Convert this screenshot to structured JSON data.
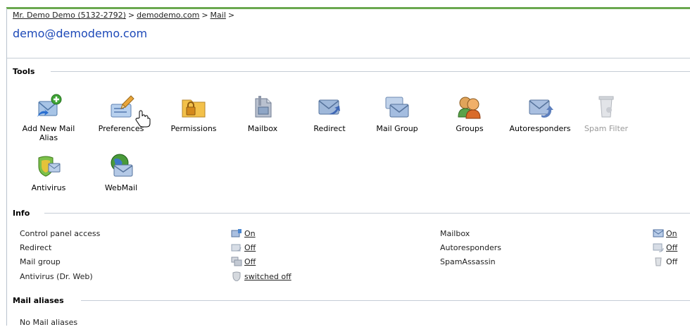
{
  "breadcrumb": {
    "items": [
      "Mr. Demo Demo (5132-2792)",
      "demodemo.com",
      "Mail"
    ],
    "separator": ">"
  },
  "page_title": "demo@demodemo.com",
  "tools": {
    "heading": "Tools",
    "items": [
      {
        "label": "Add New Mail Alias",
        "icon": "add-mail-alias-icon"
      },
      {
        "label": "Preferences",
        "icon": "preferences-icon"
      },
      {
        "label": "Permissions",
        "icon": "permissions-folder-icon"
      },
      {
        "label": "Mailbox",
        "icon": "mailbox-icon"
      },
      {
        "label": "Redirect",
        "icon": "redirect-icon"
      },
      {
        "label": "Mail Group",
        "icon": "mail-group-icon"
      },
      {
        "label": "Groups",
        "icon": "groups-icon"
      },
      {
        "label": "Autoresponders",
        "icon": "autoresponders-icon"
      },
      {
        "label": "Spam Filter",
        "icon": "spam-filter-icon",
        "disabled": true
      },
      {
        "label": "Antivirus",
        "icon": "antivirus-icon"
      },
      {
        "label": "WebMail",
        "icon": "webmail-icon"
      }
    ]
  },
  "info": {
    "heading": "Info",
    "left": [
      {
        "label": "Control panel access",
        "value": "On",
        "link": true
      },
      {
        "label": "Redirect",
        "value": "Off",
        "link": true
      },
      {
        "label": "Mail group",
        "value": "Off",
        "link": true
      },
      {
        "label": "Antivirus (Dr. Web)",
        "value": "switched off",
        "link": true
      }
    ],
    "right": [
      {
        "label": "Mailbox",
        "value": "On",
        "link": true
      },
      {
        "label": "Autoresponders",
        "value": "Off",
        "link": true
      },
      {
        "label": "SpamAssassin",
        "value": "Off",
        "link": false
      }
    ]
  },
  "mail_aliases": {
    "heading": "Mail aliases",
    "empty_text": "No Mail aliases"
  },
  "colors": {
    "accent_green": "#6aa84f",
    "title_blue": "#1d49b8"
  }
}
